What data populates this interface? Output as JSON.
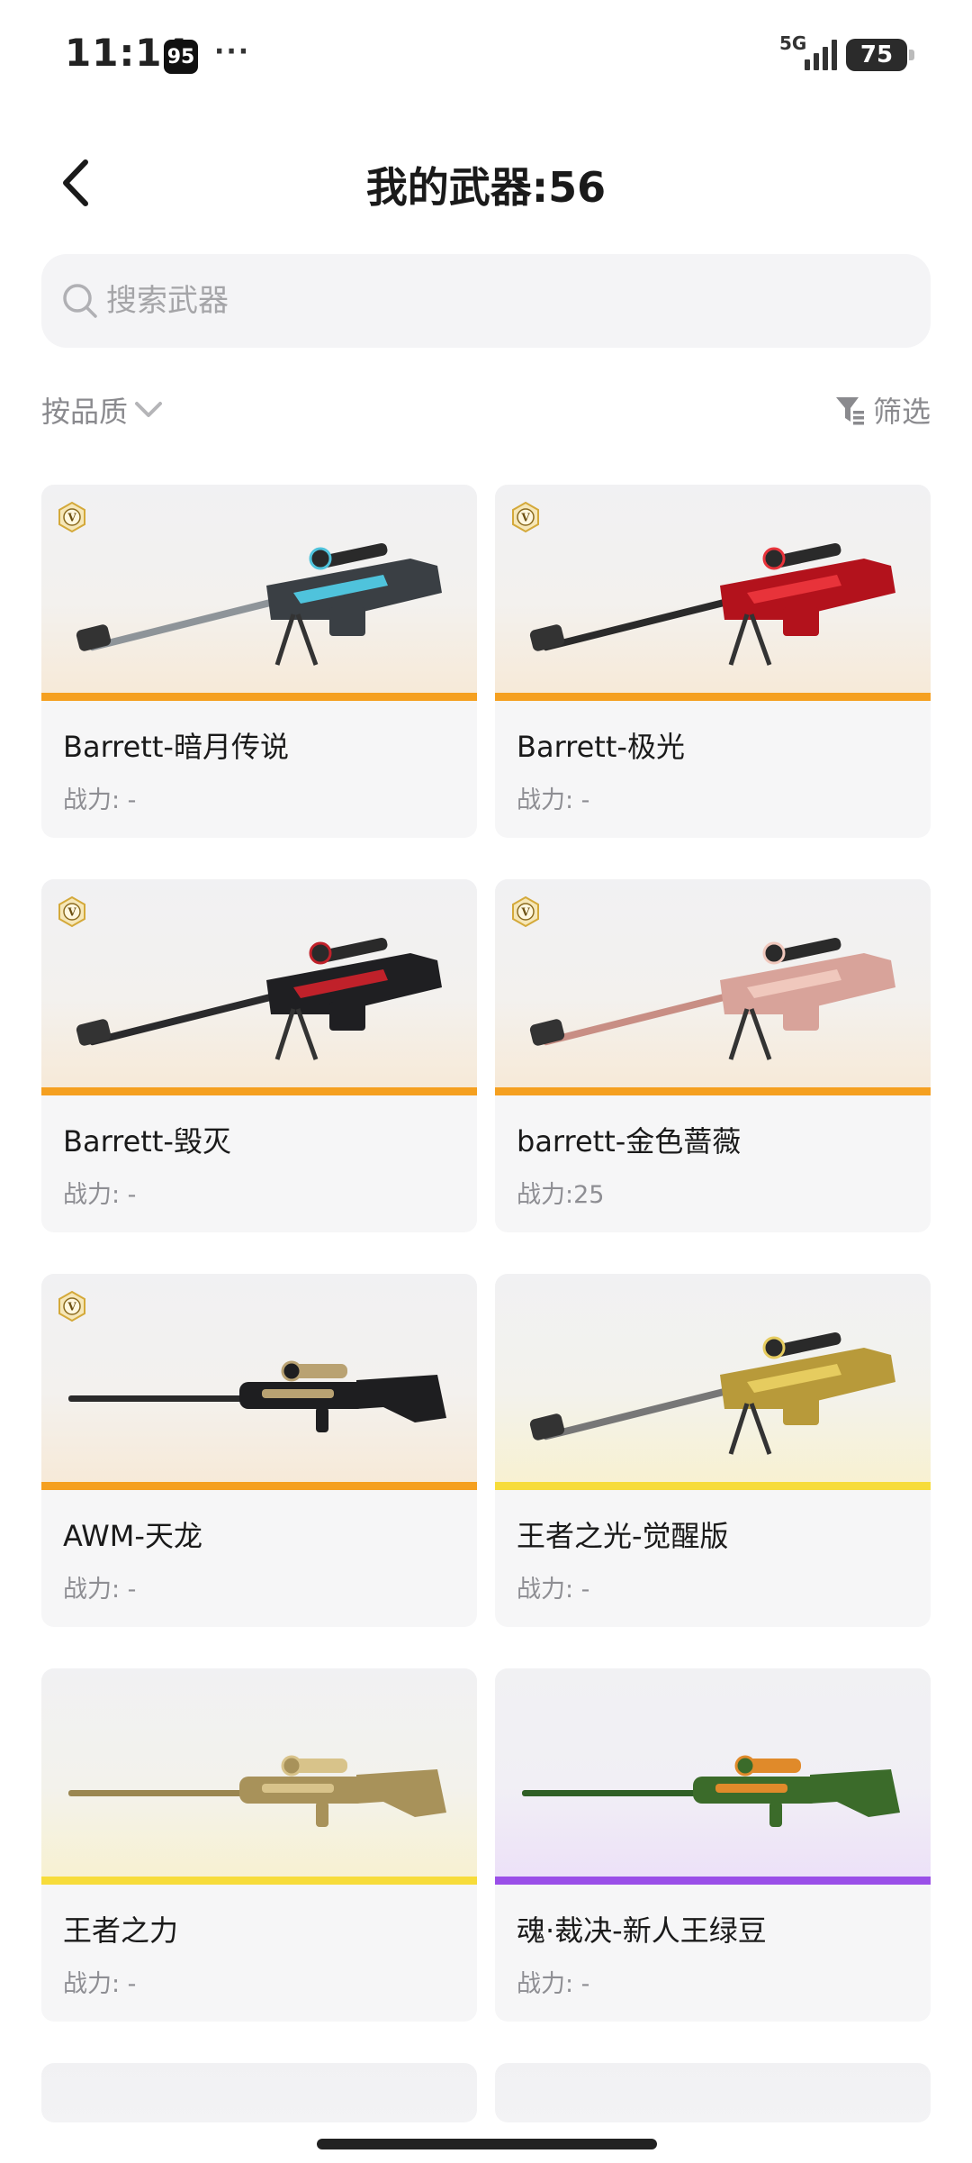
{
  "status_bar": {
    "time": "11:14",
    "app_badge": "95",
    "dots": "···",
    "network": "5G",
    "battery": "75"
  },
  "header": {
    "back_icon": "chevron-left-icon",
    "title": "我的武器:56"
  },
  "search": {
    "placeholder": "搜索武器",
    "icon": "search-icon"
  },
  "filters": {
    "sort_label": "按品质",
    "filter_label": "筛选"
  },
  "colors": {
    "orange_stripe": "#f5a020",
    "yellow_stripe": "#f7dc3a",
    "purple_stripe": "#9a4fe8",
    "card_bg": "#f6f6f7"
  },
  "weapons": [
    {
      "name": "Barrett-暗月传说",
      "power": "战力: -",
      "badge": true,
      "tier": "orange",
      "gun": "barrett-silver-cyan"
    },
    {
      "name": "Barrett-极光",
      "power": "战力: -",
      "badge": true,
      "tier": "orange",
      "gun": "barrett-red"
    },
    {
      "name": "Barrett-毁灭",
      "power": "战力: -",
      "badge": true,
      "tier": "orange",
      "gun": "barrett-black-red"
    },
    {
      "name": "barrett-金色蔷薇",
      "power": "战力:25",
      "badge": true,
      "tier": "orange",
      "gun": "barrett-rose-gold"
    },
    {
      "name": "AWM-天龙",
      "power": "战力: -",
      "badge": true,
      "tier": "orange",
      "gun": "awm-black-gold"
    },
    {
      "name": "王者之光-觉醒版",
      "power": "战力: -",
      "badge": false,
      "tier": "yellow",
      "gun": "barrett-gold"
    },
    {
      "name": "王者之力",
      "power": "战力: -",
      "badge": false,
      "tier": "yellow",
      "gun": "awm-gold"
    },
    {
      "name": "魂·裁决-新人王绿豆",
      "power": "战力: -",
      "badge": false,
      "tier": "purple",
      "gun": "awm-green-orange"
    }
  ]
}
